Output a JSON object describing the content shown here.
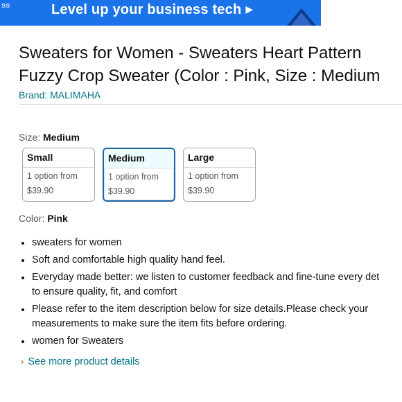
{
  "banner": {
    "edge_text": "ss",
    "headline": "Level up your business tech",
    "arrow_icon": "play-arrow-icon"
  },
  "product": {
    "title_line1": "Sweaters for Women - Sweaters Heart Pattern",
    "title_line2": "Fuzzy Crop Sweater (Color : Pink, Size : Medium",
    "brand": "Brand: MALIMAHA"
  },
  "size": {
    "label": "Size: ",
    "selected": "Medium",
    "options": [
      {
        "name": "Small",
        "line1": "1 option from",
        "price": "$39.90"
      },
      {
        "name": "Medium",
        "line1": "1 option from",
        "price": "$39.90"
      },
      {
        "name": "Large",
        "line1": "1 option from",
        "price": "$39.90"
      }
    ]
  },
  "color": {
    "label": "Color: ",
    "selected": "Pink"
  },
  "bullets": [
    [
      "sweaters for women"
    ],
    [
      "Soft and comfortable high quality hand feel."
    ],
    [
      "Everyday made better: we listen to customer feedback and fine-tune every det",
      "to ensure quality, fit, and comfort"
    ],
    [
      "Please refer to the item description below for size details.Please check your",
      "measurements to make sure the item fits before ordering."
    ],
    [
      "women for Sweaters"
    ]
  ],
  "see_more": "See more product details",
  "colors": {
    "banner": "#1a73e8",
    "link": "#007185",
    "selected_border": "#2162a1"
  }
}
